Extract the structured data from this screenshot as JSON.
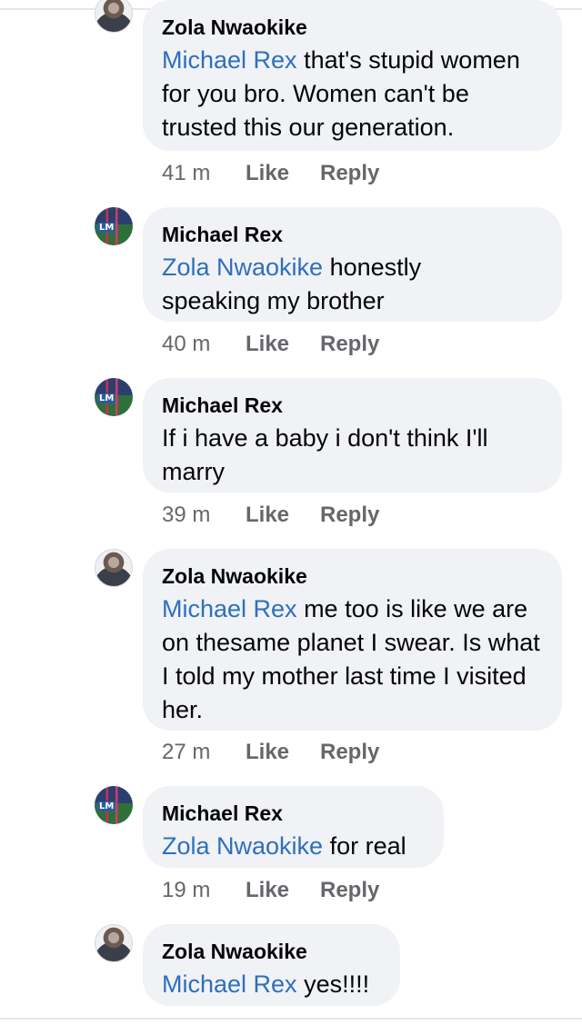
{
  "comments": [
    {
      "author": "Zola Nwaokike",
      "mention": "Michael Rex",
      "text": " that's stupid women for you bro. Women can't be trusted this our generation.",
      "time": "41 m",
      "like": "Like",
      "reply": "Reply",
      "avatar_icon": "profile-photo"
    },
    {
      "author": "Michael Rex",
      "mention": "Zola Nwaokike",
      "text": " honestly speaking my brother",
      "time": "40 m",
      "like": "Like",
      "reply": "Reply",
      "avatar_icon": "profile-photo",
      "avatar_tag": "LM"
    },
    {
      "author": "Michael Rex",
      "mention": "",
      "text": "If i have a baby i don't think I'll marry",
      "time": "39 m",
      "like": "Like",
      "reply": "Reply",
      "avatar_icon": "profile-photo",
      "avatar_tag": "LM"
    },
    {
      "author": "Zola Nwaokike",
      "mention": "Michael Rex",
      "text": " me too is like we are on thesame planet I swear. Is what I told my mother last time I visited her.",
      "time": "27 m",
      "like": "Like",
      "reply": "Reply",
      "avatar_icon": "profile-photo"
    },
    {
      "author": "Michael Rex",
      "mention": "Zola Nwaokike",
      "text": " for real",
      "time": "19 m",
      "like": "Like",
      "reply": "Reply",
      "avatar_icon": "profile-photo",
      "avatar_tag": "LM"
    },
    {
      "author": "Zola Nwaokike",
      "mention": "Michael Rex",
      "text": " yes!!!!",
      "avatar_icon": "profile-photo"
    }
  ],
  "colors": {
    "bubble": "#f0f2f5",
    "mention": "#2f6fbd",
    "meta": "#65676b",
    "text": "#050505"
  }
}
